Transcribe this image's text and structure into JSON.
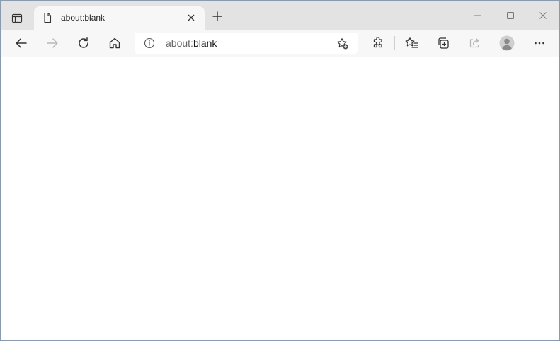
{
  "colors": {
    "titlebar": "#e3e3e3",
    "toolbar": "#f7f7f7",
    "active_tab": "#f7f7f7",
    "address_bar": "#ffffff",
    "page_background": "#ffffff",
    "icon": "#333333",
    "icon_disabled": "#b9b9b9"
  },
  "tabs": [
    {
      "title": "about:blank",
      "favicon": "page-icon",
      "active": true
    }
  ],
  "titlebar": {
    "tab_actions_icon": "tab-actions-icon",
    "new_tab_icon": "plus-icon",
    "window_controls": [
      "minimize-icon",
      "maximize-icon",
      "close-icon"
    ]
  },
  "toolbar": {
    "back_icon": "arrow-left-icon",
    "forward_icon": "arrow-right-icon",
    "forward_enabled": false,
    "refresh_icon": "refresh-icon",
    "home_icon": "home-icon",
    "extensions_icon": "puzzle-icon",
    "favorites_icon": "favorites-icon",
    "collections_icon": "collections-icon",
    "share_icon": "share-icon",
    "share_enabled": false,
    "profile_icon": "avatar-icon",
    "more_icon": "ellipsis-icon"
  },
  "address_bar": {
    "site_info_icon": "info-icon",
    "url_scheme": "about:",
    "url_rest": "blank",
    "add_favorite_icon": "star-add-icon"
  }
}
